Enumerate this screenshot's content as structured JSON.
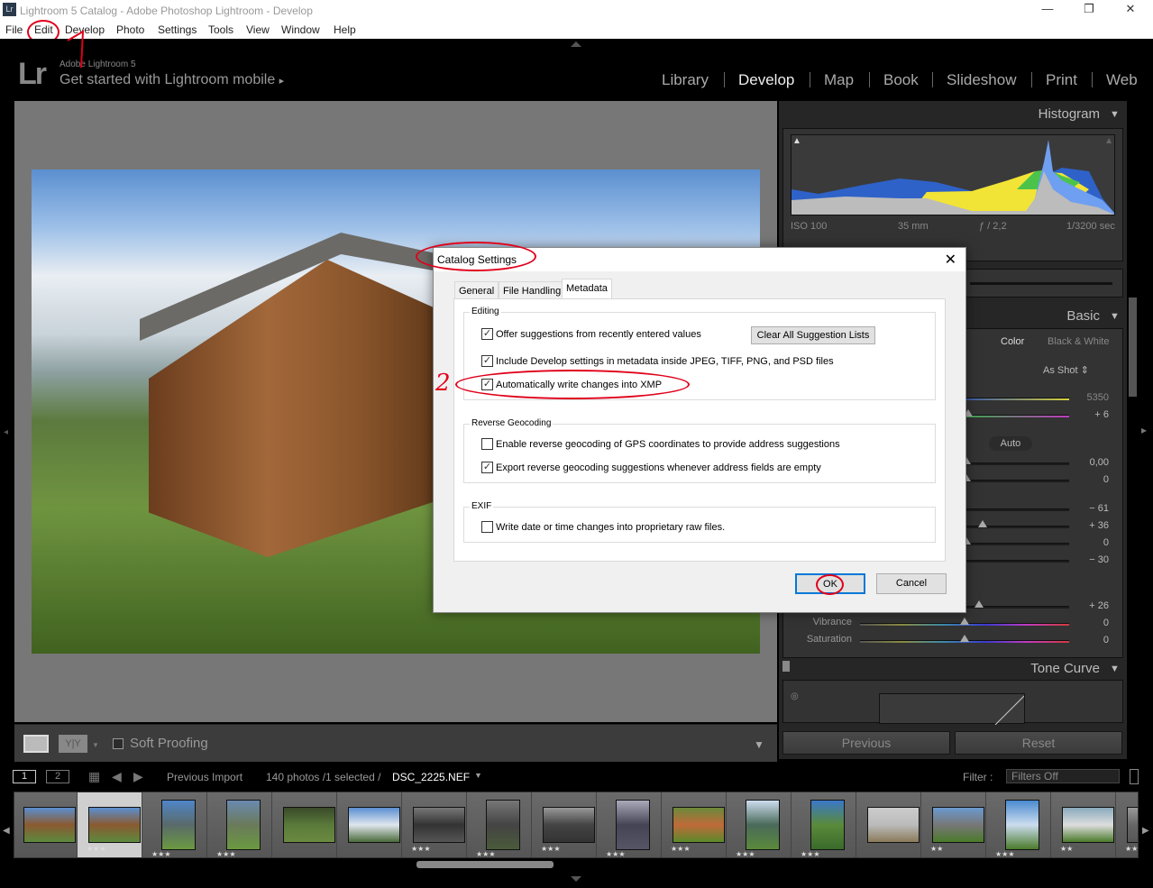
{
  "window": {
    "title": "Lightroom 5 Catalog - Adobe Photoshop Lightroom - Develop",
    "app_icon": "Lr",
    "minimize": "—",
    "maximize": "❐",
    "close": "✕"
  },
  "menu": [
    "File",
    "Edit",
    "Develop",
    "Photo",
    "Settings",
    "Tools",
    "View",
    "Window",
    "Help"
  ],
  "header": {
    "logo": "Lr",
    "subtitle": "Adobe Lightroom 5",
    "mobile": "Get started with Lightroom mobile",
    "mobile_arrow": "▸"
  },
  "modules": [
    "Library",
    "Develop",
    "Map",
    "Book",
    "Slideshow",
    "Print",
    "Web"
  ],
  "active_module": "Develop",
  "right_panel": {
    "histogram": {
      "title": "Histogram",
      "iso": "ISO 100",
      "focal": "35 mm",
      "aperture": "ƒ / 2,2",
      "shutter": "1/3200 sec"
    },
    "basic": {
      "title": "Basic",
      "treatment_color": "Color",
      "treatment_bw": "Black & White",
      "wb": "As Shot ⇕",
      "auto": "Auto",
      "values": [
        "5350",
        "+ 6",
        "0,00",
        "0",
        "− 61",
        "+ 36",
        "0",
        "− 30",
        "+ 26",
        "0",
        "0"
      ],
      "vibrance_label": "Vibrance",
      "saturation_label": "Saturation"
    },
    "tone_curve": {
      "title": "Tone Curve"
    },
    "previous": "Previous",
    "reset": "Reset"
  },
  "toolbar": {
    "soft_proofing": "Soft Proofing",
    "yy": "Y|Y"
  },
  "filmbar": {
    "view1": "1",
    "view2": "2",
    "source": "Previous Import",
    "count": "140 photos /1 selected /",
    "filename": "DSC_2225.NEF",
    "filter_label": "Filter :",
    "filter_value": "Filters Off"
  },
  "filmstrip": {
    "ratings": [
      "",
      "★★★",
      "★★★",
      "★★★",
      "",
      "",
      "★★★",
      "★★★",
      "★★★",
      "★★★",
      "★★★",
      "★★★",
      "★★★",
      "",
      "★★",
      "★★★",
      "★★",
      "★★★"
    ]
  },
  "dialog": {
    "title": "Catalog Settings",
    "close": "✕",
    "tabs": [
      "General",
      "File Handling",
      "Metadata"
    ],
    "active_tab": "Metadata",
    "editing": {
      "label": "Editing",
      "offer_suggestions": {
        "label": "Offer suggestions from recently entered values",
        "checked": true
      },
      "clear_button": "Clear All Suggestion Lists",
      "include_develop": {
        "label": "Include Develop settings in metadata inside JPEG, TIFF, PNG, and PSD files",
        "checked": true
      },
      "auto_write_xmp": {
        "label": "Automatically write changes into XMP",
        "checked": true
      }
    },
    "geocoding": {
      "label": "Reverse Geocoding",
      "enable": {
        "label": "Enable reverse geocoding of GPS coordinates to provide address suggestions",
        "checked": false
      },
      "export": {
        "label": "Export reverse geocoding suggestions whenever address fields are empty",
        "checked": true
      }
    },
    "exif": {
      "label": "EXIF",
      "write_date": {
        "label": "Write date or time changes into proprietary raw files.",
        "checked": false
      }
    },
    "ok": "OK",
    "cancel": "Cancel"
  },
  "annotations": {
    "step2": "2",
    "color": "#e0001a"
  },
  "check_mark": "✓"
}
